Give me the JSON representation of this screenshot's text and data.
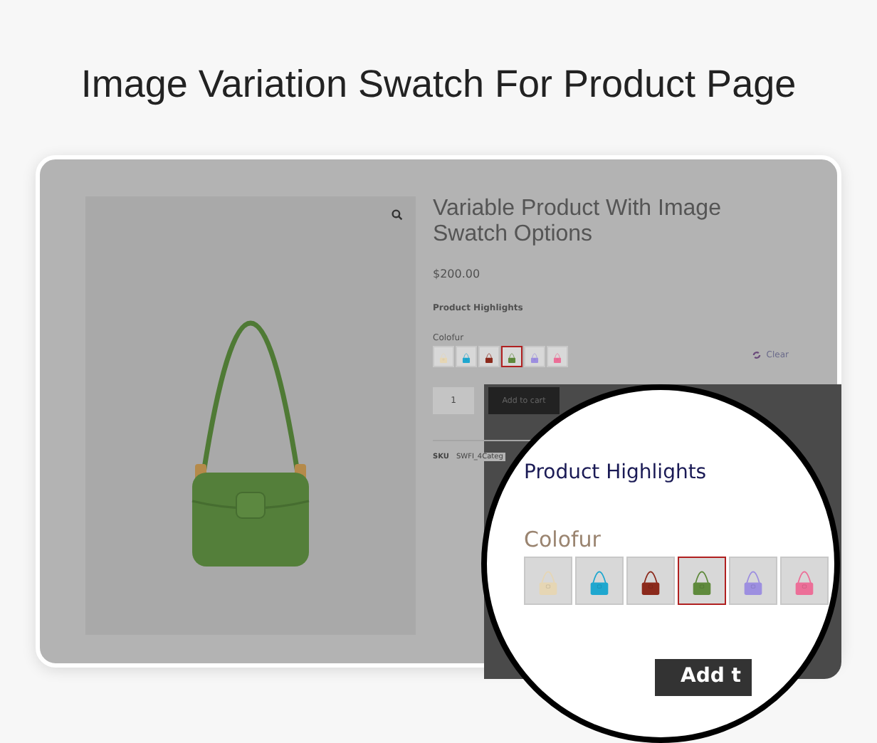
{
  "heading": "Image Variation Swatch For Product Page",
  "product": {
    "title": "Variable Product With Image Swatch Options",
    "price": "$200.00",
    "highlights": "Product Highlights",
    "attribute": "Colofur",
    "clear": "Clear",
    "quantity": "1",
    "add_to_cart": "Add to cart",
    "sku_label": "SKU",
    "sku_value": "SWFI_4Categ",
    "swatches": [
      {
        "color": "#e6d6b4",
        "selected": false
      },
      {
        "color": "#1fa7cf",
        "selected": false
      },
      {
        "color": "#8c2a1c",
        "selected": false
      },
      {
        "color": "#5f8a3c",
        "selected": true
      },
      {
        "color": "#9d8fe0",
        "selected": false
      },
      {
        "color": "#ec6f98",
        "selected": false
      }
    ]
  },
  "magnifier": {
    "highlights": "Product Highlights",
    "attribute": "Colofur",
    "add_to_cart": "Add t",
    "swatches": [
      {
        "color": "#e6d6b4",
        "selected": false
      },
      {
        "color": "#1fa7cf",
        "selected": false
      },
      {
        "color": "#8c2a1c",
        "selected": false
      },
      {
        "color": "#5f8a3c",
        "selected": true
      },
      {
        "color": "#9d8fe0",
        "selected": false
      },
      {
        "color": "#ec6f98",
        "selected": false
      }
    ]
  }
}
